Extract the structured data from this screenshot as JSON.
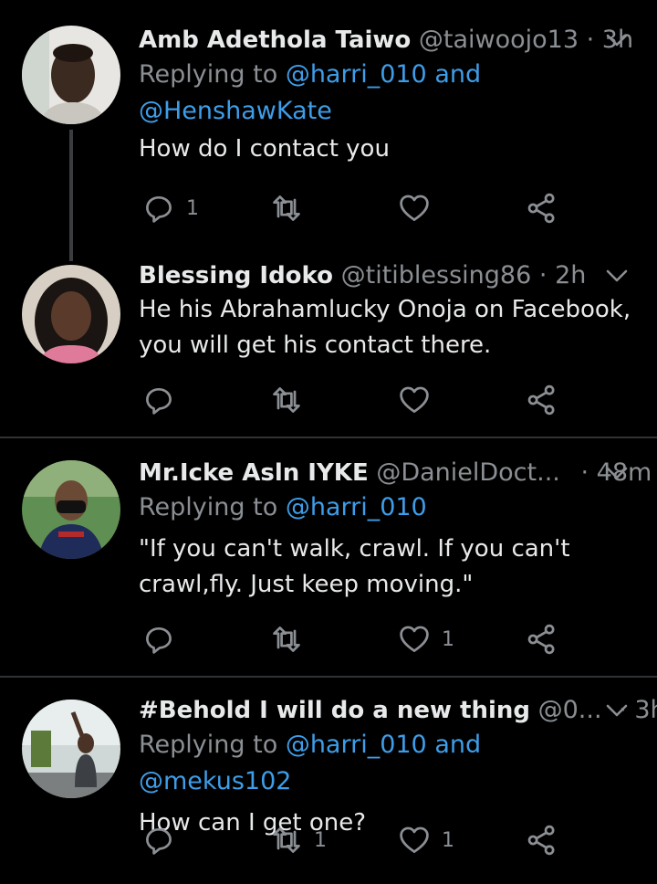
{
  "colors": {
    "background": "#000000",
    "text": "#e7e9ea",
    "secondary": "#8b8f93",
    "link": "#3e9de8",
    "divider": "#2f3336"
  },
  "tweets": [
    {
      "name": "Amb Adethola Taiwo",
      "handle": "@taiwoojo13",
      "sep": "·",
      "time": "3h",
      "reply_prefix": "Replying to",
      "reply_to": [
        "@harri_010",
        "@HenshawKate"
      ],
      "reply_and": "and",
      "text": "How do I contact you",
      "reply_count": "1",
      "retweet_count": "",
      "like_count": ""
    },
    {
      "name": "Blessing Idoko",
      "handle": "@titiblessing86",
      "sep": "·",
      "time": "2h",
      "text_lines": [
        "He his Abrahamlucky Onoja on Facebook,",
        "you will get his contact there."
      ],
      "reply_count": "",
      "retweet_count": "",
      "like_count": ""
    },
    {
      "name": "Mr.Icke Asln IYKE",
      "handle": "@DanielDoct...",
      "sep": "·",
      "time": "48m",
      "reply_prefix": "Replying to",
      "reply_to": [
        "@harri_010"
      ],
      "text_lines": [
        "\"If you can't walk, crawl. If you can't",
        "crawl,fly. Just keep moving.\""
      ],
      "reply_count": "",
      "retweet_count": "",
      "like_count": "1"
    },
    {
      "name": "#Behold I will do a new thing",
      "handle": "@0...",
      "sep": "·",
      "time": "3h",
      "reply_prefix": "Replying to",
      "reply_to": [
        "@harri_010",
        "@mekus102"
      ],
      "reply_and": "and",
      "text": "How can I get one?",
      "reply_count": "",
      "retweet_count": "1",
      "like_count": "1"
    }
  ],
  "icons": {
    "reply": "reply-icon",
    "retweet": "retweet-icon",
    "like": "heart-icon",
    "share": "share-icon",
    "more": "chevron-down-icon"
  }
}
